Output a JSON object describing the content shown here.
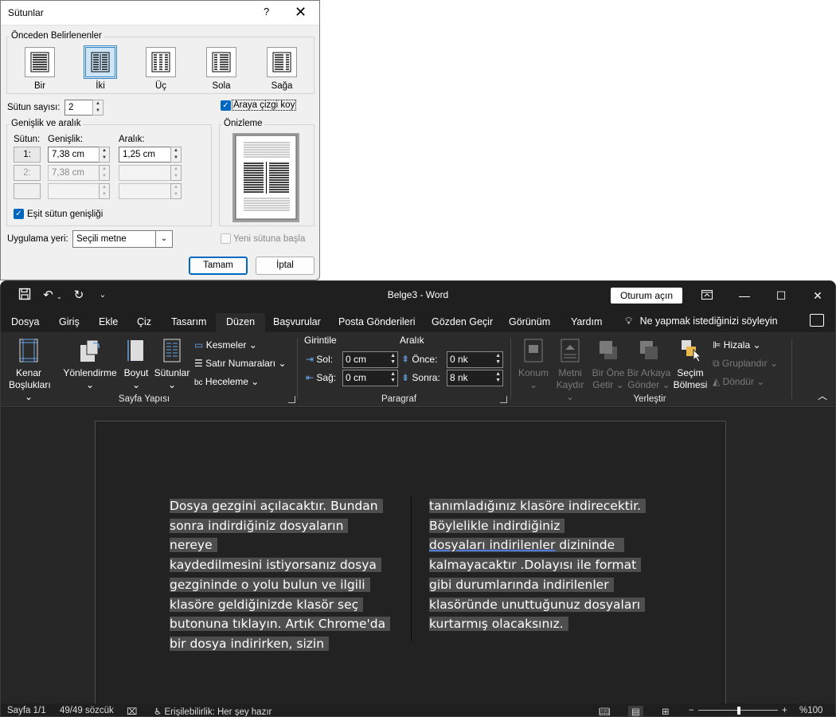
{
  "dialog": {
    "title": "Sütunlar",
    "help": "?",
    "close": "✕",
    "presets_group": "Önceden Belirlenenler",
    "presets": [
      {
        "label": "Bir"
      },
      {
        "label": "İki"
      },
      {
        "label": "Üç"
      },
      {
        "label": "Sola"
      },
      {
        "label": "Sağa"
      }
    ],
    "column_count_label": "Sütun sayısı:",
    "column_count_value": "2",
    "line_between_label": "Araya çizgi koy",
    "width_spacing_group": "Genişlik ve aralık",
    "col_header": "Sütun:",
    "width_header": "Genişlik:",
    "spacing_header": "Aralık:",
    "rows": [
      {
        "num": "1:",
        "width": "7,38 cm",
        "spacing": "1,25 cm"
      },
      {
        "num": "2:",
        "width": "7,38 cm",
        "spacing": ""
      },
      {
        "num": "",
        "width": "",
        "spacing": ""
      }
    ],
    "equal_width_label": "Eşit sütun genişliği",
    "preview_group": "Önizleme",
    "apply_label": "Uygulama yeri:",
    "apply_value": "Seçili metne",
    "new_column_label": "Yeni sütuna başla",
    "ok": "Tamam",
    "cancel": "İptal"
  },
  "word": {
    "doc_title": "Belge3  -  Word",
    "signin": "Oturum açın",
    "tabs": [
      "Dosya",
      "Giriş",
      "Ekle",
      "Çiz",
      "Tasarım",
      "Düzen",
      "Başvurular",
      "Posta Gönderileri",
      "Gözden Geçir",
      "Görünüm",
      "Yardım"
    ],
    "tell_me": "Ne yapmak istediğinizi söyleyin",
    "ribbon": {
      "margins": [
        "Kenar",
        "Boşlukları ⌄"
      ],
      "orientation": [
        "Yönlendirme",
        "⌄"
      ],
      "size": [
        "Boyut",
        "⌄"
      ],
      "columns": [
        "Sütunlar",
        "⌄"
      ],
      "breaks": "Kesmeler ⌄",
      "line_numbers": "Satır Numaraları ⌄",
      "hyphenation": "Heceleme ⌄",
      "page_setup_group": "Sayfa Yapısı",
      "indent_header": "Girintile",
      "spacing_header": "Aralık",
      "left_label": "Sol:",
      "left_value": "0 cm",
      "right_label": "Sağ:",
      "right_value": "0 cm",
      "before_label": "Önce:",
      "before_value": "0 nk",
      "after_label": "Sonra:",
      "after_value": "8 nk",
      "paragraph_group": "Paragraf",
      "position": [
        "Konum",
        "⌄"
      ],
      "wrap_text": [
        "Metni",
        "Kaydır ⌄"
      ],
      "bring_forward": [
        "Bir Öne",
        "Getir ⌄"
      ],
      "send_backward": [
        "Bir Arkaya",
        "Gönder ⌄"
      ],
      "selection_pane": [
        "Seçim",
        "Bölmesi"
      ],
      "align": "Hizala ⌄",
      "group": "Gruplandır ⌄",
      "rotate": "Döndür ⌄",
      "arrange_group": "Yerleştir"
    },
    "col1_lines": [
      "Dosya gezgini açılacaktır. Bundan",
      "sonra indirdiğiniz dosyaların nereye",
      "kaydedilmesini istiyorsanız dosya",
      "gezgininde o yolu bulun ve ilgili",
      "klasöre geldiğinizde klasör seç",
      "butonuna tıklayın. Artık Chrome'da",
      "bir dosya indirirken, sizin"
    ],
    "col2_lines": [
      "tanımladığınız klasöre indirecektir.",
      "Böylelikle indirdiğiniz",
      "dosyaları  indirilenler",
      " dizininde",
      "kalmayacaktır .Dolayısı ile format",
      "gibi durumlarında indirilenler",
      "klasöründe unuttuğunuz dosyaları",
      "kurtarmış olacaksınız."
    ],
    "status": {
      "page": "Sayfa 1/1",
      "words": "49/49 sözcük",
      "accessibility": "Erişilebilirlik: Her şey hazır",
      "zoom": "%100"
    }
  }
}
